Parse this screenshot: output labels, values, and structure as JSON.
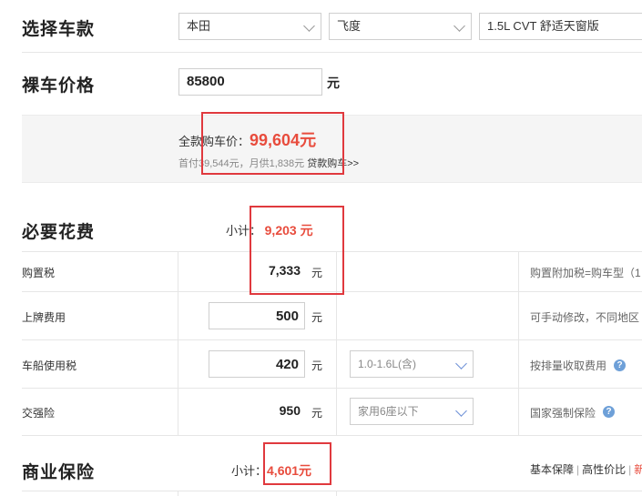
{
  "select_car": {
    "title": "选择车款",
    "brand": "本田",
    "series": "飞度",
    "model": "1.5L CVT 舒适天窗版"
  },
  "bare_price": {
    "title": "裸车价格",
    "value": "85800",
    "unit": "元"
  },
  "summary": {
    "total_label": "全款购车价：",
    "total_value": "99,604元",
    "loan_text": "首付39,544元，月供1,838元",
    "loan_link": "贷款购车>>"
  },
  "required": {
    "title": "必要花费",
    "subtotal_label": "小计：",
    "subtotal_value": "9,203 元",
    "rows": [
      {
        "label": "购置税",
        "value": "7,333",
        "unit": "元",
        "note": "购置附加税=购车型（1"
      },
      {
        "label": "上牌费用",
        "value": "500",
        "unit": "元",
        "note": "可手动修改，不同地区"
      },
      {
        "label": "车船使用税",
        "value": "420",
        "unit": "元",
        "option": "1.0-1.6L(含)",
        "note": "按排量收取费用"
      },
      {
        "label": "交强险",
        "value": "950",
        "unit": "元",
        "option": "家用6座以下",
        "note": "国家强制保险"
      }
    ]
  },
  "insurance": {
    "title": "商业保险",
    "subtotal_label": "小计：",
    "subtotal_value": "4,601元",
    "tabs": [
      "基本保障",
      "高性价比",
      "新"
    ]
  },
  "icons": {
    "dropdown": "chevron-down-icon",
    "help": "question-icon"
  },
  "colors": {
    "accent_red": "#e84c3d",
    "highlight_border": "#e0393e",
    "help_blue": "#6ea0d8"
  }
}
